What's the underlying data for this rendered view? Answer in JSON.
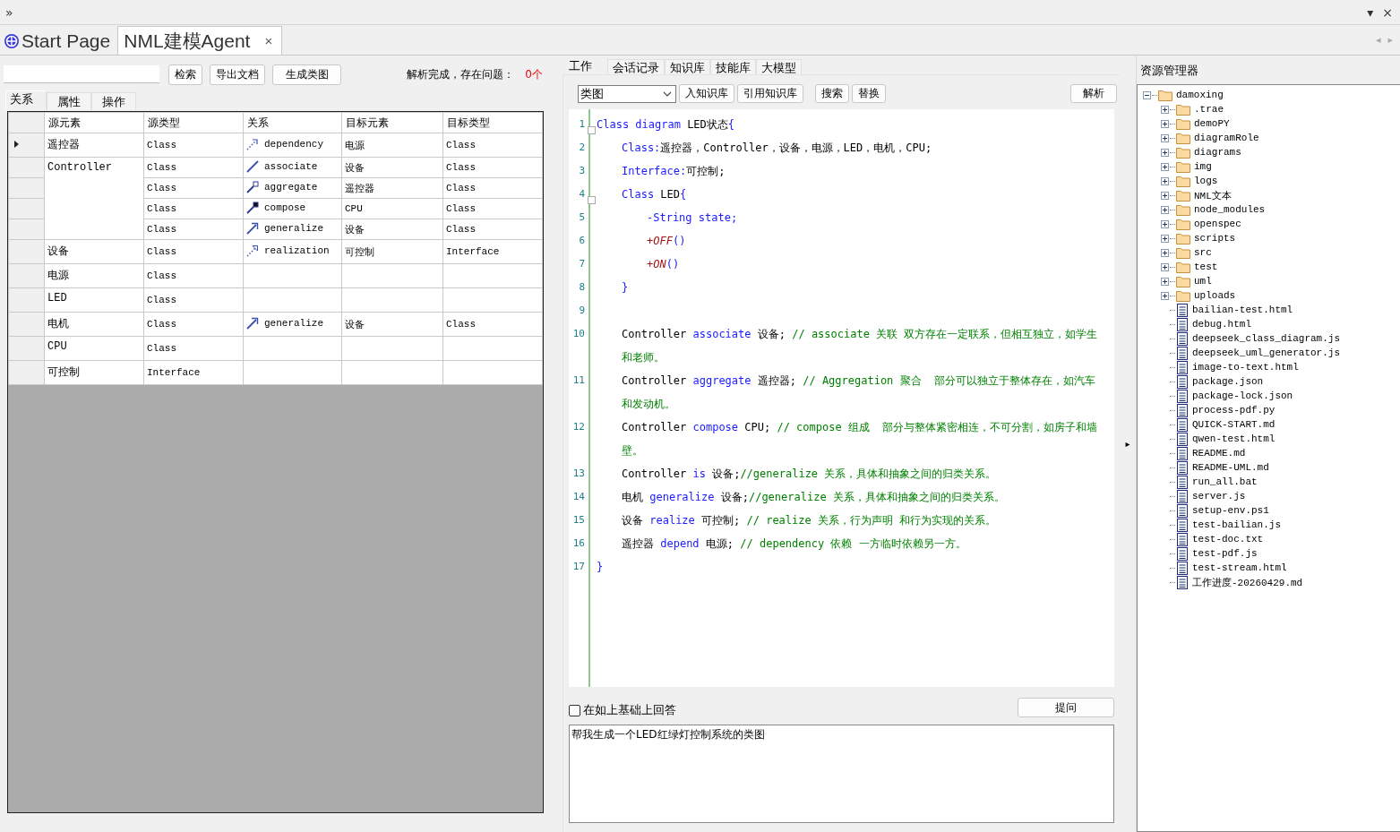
{
  "top_bar": {
    "overflow": "»",
    "menu": "▾",
    "close": "×"
  },
  "doc_tabs": [
    {
      "label": "Start Page",
      "selected": false,
      "kind": "start"
    },
    {
      "label": "NML建模Agent",
      "selected": true,
      "kind": "document",
      "close": "×"
    }
  ],
  "tab_scroll": {
    "left": "◂",
    "right": "▸"
  },
  "left": {
    "toolbar": {
      "buttons": [
        "检索",
        "导出文档",
        "生成类图"
      ],
      "status": "解析完成，存在问题：",
      "issues": "0个"
    },
    "tabs": [
      {
        "label": "关系",
        "selected": true
      },
      {
        "label": "属性",
        "selected": false
      },
      {
        "label": "操作",
        "selected": false
      }
    ],
    "table": {
      "columns": [
        "源元素",
        "源类型",
        "关系",
        "目标元素",
        "目标类型"
      ],
      "groups": [
        {
          "source": "遥控器",
          "rows": [
            {
              "selected": true,
              "source_type": "Class",
              "relation": "dependency",
              "kind": "dependency",
              "target": "电源",
              "target_type": "Class"
            }
          ]
        },
        {
          "source": "Controller",
          "rows": [
            {
              "selected": false,
              "source_type": "Class",
              "relation": "associate",
              "kind": "associate",
              "target": "设备",
              "target_type": "Class"
            },
            {
              "selected": false,
              "source_type": "Class",
              "relation": "aggregate",
              "kind": "aggregate",
              "target": "遥控器",
              "target_type": "Class"
            },
            {
              "selected": false,
              "source_type": "Class",
              "relation": "compose",
              "kind": "compose",
              "target": "CPU",
              "target_type": "Class"
            },
            {
              "selected": false,
              "source_type": "Class",
              "relation": "generalize",
              "kind": "generalize",
              "target": "设备",
              "target_type": "Class"
            }
          ]
        },
        {
          "source": "设备",
          "rows": [
            {
              "selected": false,
              "source_type": "Class",
              "relation": "realization",
              "kind": "realization",
              "target": "可控制",
              "target_type": "Interface"
            }
          ]
        },
        {
          "source": "电源",
          "rows": [
            {
              "selected": false,
              "source_type": "Class"
            }
          ]
        },
        {
          "source": "LED",
          "rows": [
            {
              "selected": false,
              "source_type": "Class"
            }
          ]
        },
        {
          "source": "电机",
          "rows": [
            {
              "selected": false,
              "source_type": "Class",
              "relation": "generalize",
              "kind": "generalize",
              "target": "设备",
              "target_type": "Class"
            }
          ]
        },
        {
          "source": "CPU",
          "rows": [
            {
              "selected": false,
              "source_type": "Class"
            }
          ]
        },
        {
          "source": "可控制",
          "rows": [
            {
              "selected": false,
              "source_type": "Interface"
            }
          ]
        }
      ]
    }
  },
  "middle": {
    "tabs": [
      {
        "label": "工作",
        "selected": true
      },
      {
        "label": "会话记录",
        "selected": false
      },
      {
        "label": "知识库",
        "selected": false
      },
      {
        "label": "技能库",
        "selected": false
      },
      {
        "label": "大模型",
        "selected": false
      }
    ],
    "diagram_type": "类图",
    "buttons": [
      "入知识库",
      "引用知识库",
      "搜索",
      "替换"
    ],
    "parse_button": "解析",
    "code": [
      {
        "number": "1",
        "tokens": [
          {
            "kind": "keyword",
            "text": "Class diagram"
          },
          {
            "kind": "text",
            "text": " LED状态"
          },
          {
            "kind": "symbol",
            "text": "{"
          }
        ],
        "children": [
          {
            "number": "2",
            "tokens": [
              {
                "kind": "keyword",
                "text": "Class:"
              },
              {
                "kind": "text",
                "text": "遥控器，Controller，设备，电源，LED，电机，CPU;"
              }
            ]
          },
          {
            "number": "3",
            "tokens": [
              {
                "kind": "keyword",
                "text": "Interface:"
              },
              {
                "kind": "text",
                "text": "可控制;"
              }
            ]
          },
          {
            "number": "4",
            "tokens": [
              {
                "kind": "keyword",
                "text": "Class"
              },
              {
                "kind": "text",
                "text": " LED"
              },
              {
                "kind": "symbol",
                "text": "{"
              }
            ],
            "children": [
              {
                "number": "5",
                "tokens": [
                  {
                    "kind": "keyword",
                    "text": "-String state;"
                  }
                ]
              },
              {
                "number": "6",
                "tokens": [
                  {
                    "kind": "method",
                    "text": "+OFF"
                  },
                  {
                    "kind": "symbol",
                    "text": "()"
                  }
                ]
              },
              {
                "number": "7",
                "tokens": [
                  {
                    "kind": "method",
                    "text": "+ON"
                  },
                  {
                    "kind": "symbol",
                    "text": "()"
                  }
                ]
              }
            ]
          },
          {
            "number": "8",
            "tokens": [
              {
                "kind": "symbol",
                "text": "}"
              }
            ]
          },
          {
            "number": "9"
          },
          {
            "number": "10",
            "tokens": [
              {
                "kind": "text",
                "text": "Controller "
              },
              {
                "kind": "keyword",
                "text": "associate"
              },
              {
                "kind": "text",
                "text": " 设备; "
              },
              {
                "kind": "comment",
                "text": "// associate 关联 双方存在一定联系，但相互独立，如学生和老师。"
              }
            ]
          },
          {
            "number": "11",
            "tokens": [
              {
                "kind": "text",
                "text": "Controller "
              },
              {
                "kind": "keyword",
                "text": "aggregate"
              },
              {
                "kind": "text",
                "text": " 遥控器; "
              },
              {
                "kind": "comment",
                "text": "// Aggregation 聚合  部分可以独立于整体存在，如汽车和发动机。"
              }
            ]
          },
          {
            "number": "12",
            "tokens": [
              {
                "kind": "text",
                "text": "Controller "
              },
              {
                "kind": "keyword",
                "text": "compose"
              },
              {
                "kind": "text",
                "text": " CPU; "
              },
              {
                "kind": "comment",
                "text": "// compose 组成  部分与整体紧密相连，不可分割，如房子和墙壁。"
              }
            ]
          },
          {
            "number": "13",
            "tokens": [
              {
                "kind": "text",
                "text": "Controller "
              },
              {
                "kind": "keyword",
                "text": "is"
              },
              {
                "kind": "text",
                "text": " 设备;"
              },
              {
                "kind": "comment",
                "text": "//generalize 关系，具体和抽象之间的归类关系。"
              }
            ]
          },
          {
            "number": "14",
            "tokens": [
              {
                "kind": "text",
                "text": "电机 "
              },
              {
                "kind": "keyword",
                "text": "generalize"
              },
              {
                "kind": "text",
                "text": " 设备;"
              },
              {
                "kind": "comment",
                "text": "//generalize 关系，具体和抽象之间的归类关系。"
              }
            ]
          },
          {
            "number": "15",
            "tokens": [
              {
                "kind": "text",
                "text": "设备 "
              },
              {
                "kind": "keyword",
                "text": "realize"
              },
              {
                "kind": "text",
                "text": " 可控制; "
              },
              {
                "kind": "comment",
                "text": "// realize 关系，行为声明 和行为实现的关系。"
              }
            ]
          },
          {
            "number": "16",
            "tokens": [
              {
                "kind": "text",
                "text": "遥控器 "
              },
              {
                "kind": "keyword",
                "text": "depend"
              },
              {
                "kind": "text",
                "text": " 电源; "
              },
              {
                "kind": "comment",
                "text": "// dependency 依赖 一方临时依赖另一方。"
              }
            ]
          }
        ]
      },
      {
        "number": "17",
        "tokens": [
          {
            "kind": "symbol",
            "text": "}"
          }
        ]
      }
    ],
    "answer_option": {
      "label": "在如上基础上回答",
      "checked": false
    },
    "ask_button": "提问",
    "prompt": "帮我生成一个LED红绿灯控制系统的类图"
  },
  "splitter": "▸",
  "explorer": {
    "title": "资源管理器",
    "tree": [
      {
        "name": "damoxing",
        "kind": "folder",
        "expanded": true,
        "children": [
          {
            "name": ".trae",
            "kind": "folder",
            "expanded": false
          },
          {
            "name": "demoPY",
            "kind": "folder",
            "expanded": false
          },
          {
            "name": "diagramRole",
            "kind": "folder",
            "expanded": false
          },
          {
            "name": "diagrams",
            "kind": "folder",
            "expanded": false
          },
          {
            "name": "img",
            "kind": "folder",
            "expanded": false
          },
          {
            "name": "logs",
            "kind": "folder",
            "expanded": false
          },
          {
            "name": "NML文本",
            "kind": "folder",
            "expanded": false
          },
          {
            "name": "node_modules",
            "kind": "folder",
            "expanded": false
          },
          {
            "name": "openspec",
            "kind": "folder",
            "expanded": false
          },
          {
            "name": "scripts",
            "kind": "folder",
            "expanded": false
          },
          {
            "name": "src",
            "kind": "folder",
            "expanded": false
          },
          {
            "name": "test",
            "kind": "folder",
            "expanded": false
          },
          {
            "name": "uml",
            "kind": "folder",
            "expanded": false
          },
          {
            "name": "uploads",
            "kind": "folder",
            "expanded": false
          },
          {
            "name": "bailian-test.html",
            "kind": "file"
          },
          {
            "name": "debug.html",
            "kind": "file"
          },
          {
            "name": "deepseek_class_diagram.js",
            "kind": "file"
          },
          {
            "name": "deepseek_uml_generator.js",
            "kind": "file"
          },
          {
            "name": "image-to-text.html",
            "kind": "file"
          },
          {
            "name": "package.json",
            "kind": "file"
          },
          {
            "name": "package-lock.json",
            "kind": "file"
          },
          {
            "name": "process-pdf.py",
            "kind": "file"
          },
          {
            "name": "QUICK-START.md",
            "kind": "file"
          },
          {
            "name": "qwen-test.html",
            "kind": "file"
          },
          {
            "name": "README.md",
            "kind": "file"
          },
          {
            "name": "README-UML.md",
            "kind": "file"
          },
          {
            "name": "run_all.bat",
            "kind": "file"
          },
          {
            "name": "server.js",
            "kind": "file"
          },
          {
            "name": "setup-env.ps1",
            "kind": "file"
          },
          {
            "name": "test-bailian.js",
            "kind": "file"
          },
          {
            "name": "test-doc.txt",
            "kind": "file"
          },
          {
            "name": "test-pdf.js",
            "kind": "file"
          },
          {
            "name": "test-stream.html",
            "kind": "file"
          },
          {
            "name": "工作进度-20260429.md",
            "kind": "file"
          }
        ]
      }
    ]
  }
}
